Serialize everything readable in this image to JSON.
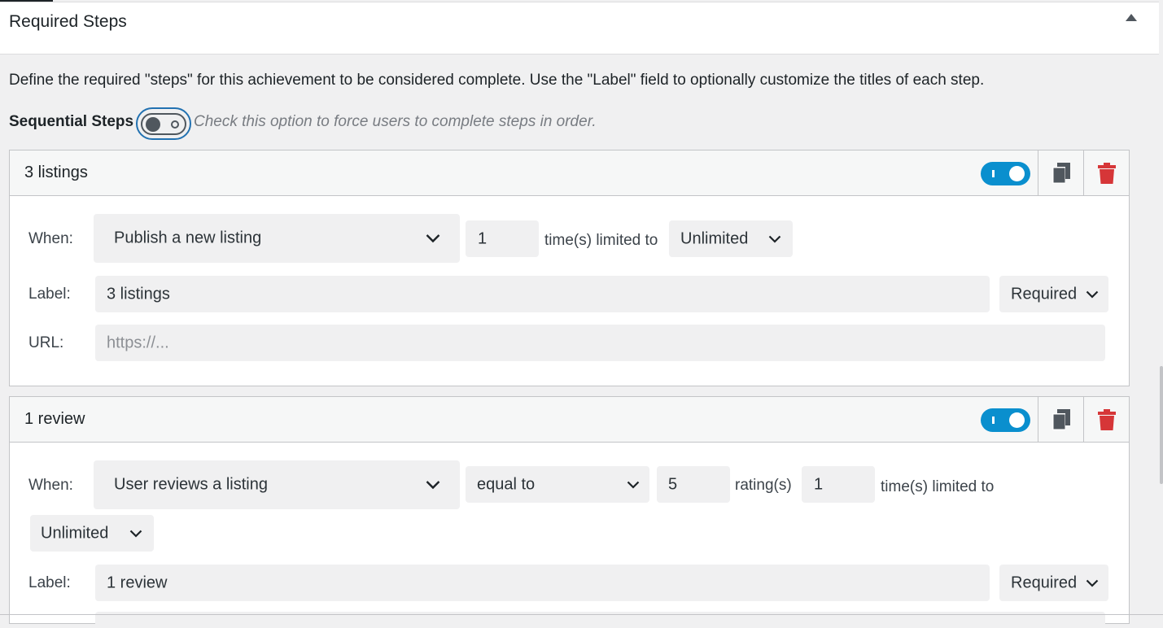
{
  "panel": {
    "title": "Required Steps",
    "description": "Define the required \"steps\" for this achievement to be considered complete. Use the \"Label\" field to optionally customize the titles of each step.",
    "sequential_label": "Sequential Steps",
    "sequential_help": "Check this option to force users to complete steps in order.",
    "sequential_enabled": false
  },
  "labels": {
    "when": "When:",
    "label": "Label:",
    "url": "URL:"
  },
  "icons": {
    "collapse": "triangle-up-icon",
    "copy": "copy-icon",
    "delete": "trash-icon",
    "chevron": "chevron-down-icon"
  },
  "colors": {
    "toggle_on": "#0a8fce",
    "delete": "#d63638",
    "focus_ring": "#2271b1"
  },
  "steps": [
    {
      "title": "3 listings",
      "enabled": true,
      "trigger": "Publish a new listing",
      "count": "1",
      "times_limited_text": "time(s) limited to",
      "limit": "Unlimited",
      "label_value": "3 listings",
      "required": "Required",
      "url_placeholder": "https://..."
    },
    {
      "title": "1 review",
      "enabled": true,
      "trigger": "User reviews a listing",
      "comparison": "equal to",
      "rating": "5",
      "rating_text": "rating(s)",
      "count": "1",
      "times_limited_text": "time(s) limited to",
      "limit": "Unlimited",
      "label_value": "1 review",
      "required": "Required"
    }
  ]
}
